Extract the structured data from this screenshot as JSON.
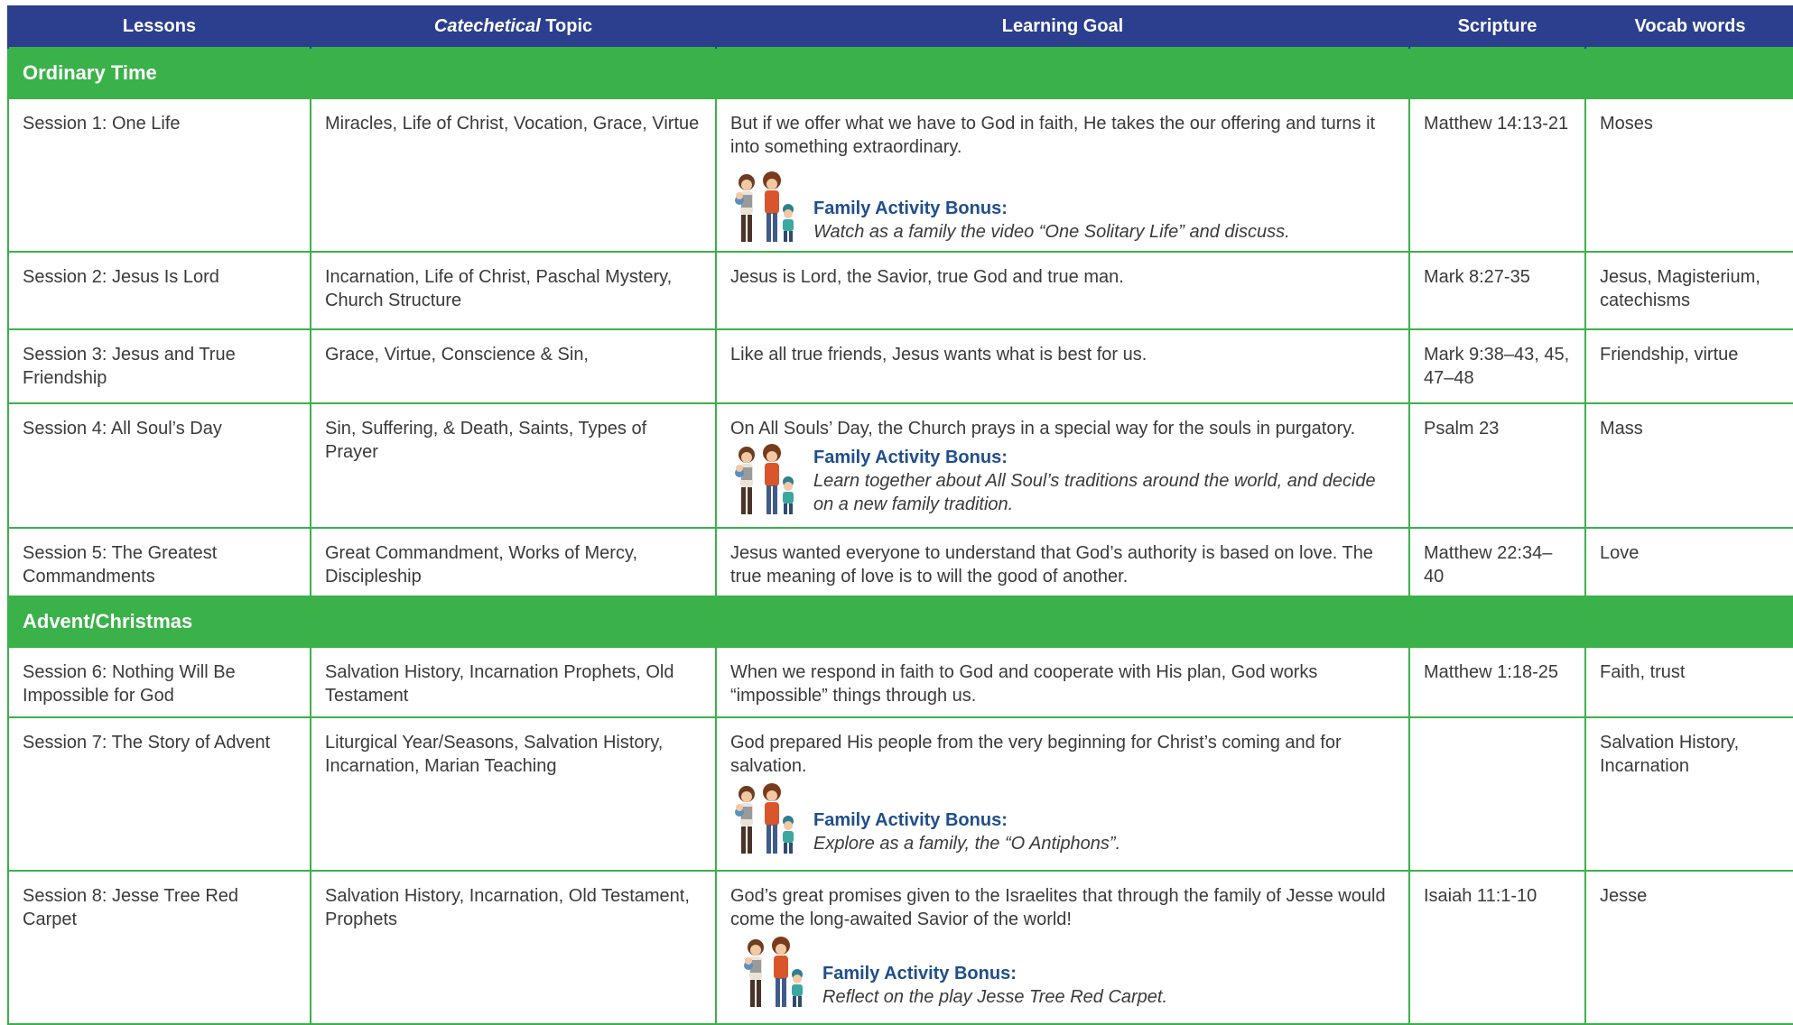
{
  "header": {
    "col_lessons": "Lessons",
    "col_topic_italic": "Catechetical",
    "col_topic_rest": " Topic",
    "col_goal": "Learning Goal",
    "col_scripture": "Scripture",
    "col_vocab": "Vocab words"
  },
  "bonus_label": "Family Activity Bonus:",
  "sections": [
    {
      "title": "Ordinary Time",
      "rows": [
        {
          "lesson": "Session 1: One Life",
          "topic": "Miracles, Life of Christ, Vocation, Grace, Virtue",
          "goal": "But if we offer what we have to God in faith, He takes the our offering and turns it into something extraordinary.",
          "bonus": "Watch as a family the video “One Solitary Life” and discuss.",
          "scripture": "Matthew 14:13-21",
          "vocab": "Moses"
        },
        {
          "lesson": "Session 2: Jesus Is Lord",
          "topic": "Incarnation, Life of Christ, Paschal Mystery, Church Structure",
          "goal": "Jesus is Lord, the Savior, true God and true man.",
          "scripture": "Mark 8:27-35",
          "vocab": "Jesus, Magisterium, catechisms"
        },
        {
          "lesson": "Session 3: Jesus and True Friendship",
          "topic": "Grace, Virtue, Conscience & Sin,",
          "goal": "Like all true friends, Jesus wants what is best for us.",
          "scripture": "Mark 9:38–43, 45, 47–48",
          "vocab": "Friendship, virtue"
        },
        {
          "lesson": "Session 4: All Soul’s Day",
          "topic": "Sin, Suffering, & Death, Saints, Types of Prayer",
          "goal": "On All Souls’ Day, the Church prays in a special way for the souls in purgatory.",
          "bonus": "Learn together about All Soul’s traditions around the world, and decide on a new family tradition.",
          "scripture": "Psalm 23",
          "vocab": "Mass"
        },
        {
          "lesson": "Session 5:  The Greatest Commandments",
          "topic": "Great Commandment, Works of Mercy, Discipleship",
          "goal": "Jesus wanted everyone to understand that God’s authority is based on love. The true meaning of love is to will the good of another.",
          "scripture": "Matthew 22:34–40",
          "vocab": "Love"
        }
      ]
    },
    {
      "title": "Advent/Christmas",
      "rows": [
        {
          "lesson": "Session 6: Nothing Will Be Impossible for God",
          "topic": "Salvation History, Incarnation Prophets, Old Testament",
          "goal": "When we respond in faith to God and cooperate with His plan, God works “impossible” things through us.",
          "scripture": "Matthew 1:18-25",
          "vocab": "Faith, trust"
        },
        {
          "lesson": "Session 7: The Story of Advent",
          "topic": "Liturgical Year/Seasons, Salvation History, Incarnation, Marian Teaching",
          "goal": "God prepared His people from the very beginning for Christ’s coming and for salvation.",
          "bonus": "Explore as a family, the “O Antiphons”.",
          "scripture": "",
          "vocab": "Salvation History, Incarnation"
        },
        {
          "lesson": "Session 8: Jesse Tree Red Carpet",
          "topic": "Salvation History, Incarnation, Old Testament, Prophets",
          "goal": "God’s great promises given to the Israelites that through the family of Jesse would come the long-awaited Savior of the world!",
          "bonus": "Reflect on the play Jesse Tree Red Carpet.",
          "scripture": "Isaiah 11:1-10",
          "vocab": "Jesse"
        }
      ]
    }
  ]
}
